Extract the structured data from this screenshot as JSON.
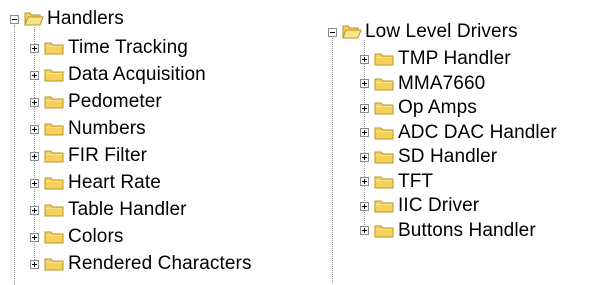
{
  "left_tree": {
    "root_label": "Handlers",
    "root_state": "expanded",
    "items": [
      {
        "label": "Time Tracking",
        "state": "collapsed"
      },
      {
        "label": "Data Acquisition",
        "state": "collapsed"
      },
      {
        "label": "Pedometer",
        "state": "collapsed"
      },
      {
        "label": "Numbers",
        "state": "collapsed"
      },
      {
        "label": "FIR Filter",
        "state": "collapsed"
      },
      {
        "label": "Heart Rate",
        "state": "collapsed"
      },
      {
        "label": "Table Handler",
        "state": "collapsed"
      },
      {
        "label": "Colors",
        "state": "collapsed"
      },
      {
        "label": "Rendered Characters",
        "state": "collapsed"
      }
    ]
  },
  "right_tree": {
    "root_label": "Low Level Drivers",
    "root_state": "expanded",
    "items": [
      {
        "label": "TMP Handler",
        "state": "collapsed"
      },
      {
        "label": "MMA7660",
        "state": "collapsed"
      },
      {
        "label": "Op Amps",
        "state": "collapsed"
      },
      {
        "label": "ADC DAC Handler",
        "state": "collapsed"
      },
      {
        "label": "SD Handler",
        "state": "collapsed"
      },
      {
        "label": "TFT",
        "state": "collapsed"
      },
      {
        "label": "IIC Driver",
        "state": "collapsed"
      },
      {
        "label": "Buttons Handler",
        "state": "collapsed"
      }
    ]
  },
  "icons": {
    "folder_closed": "folder-closed-icon",
    "folder_open": "folder-open-icon",
    "expand": "plus-expander-icon",
    "collapse": "minus-expander-icon"
  },
  "colors": {
    "folder_fill": "#f5d15a",
    "folder_dark": "#b8962a",
    "connector": "#9a9a9a"
  }
}
